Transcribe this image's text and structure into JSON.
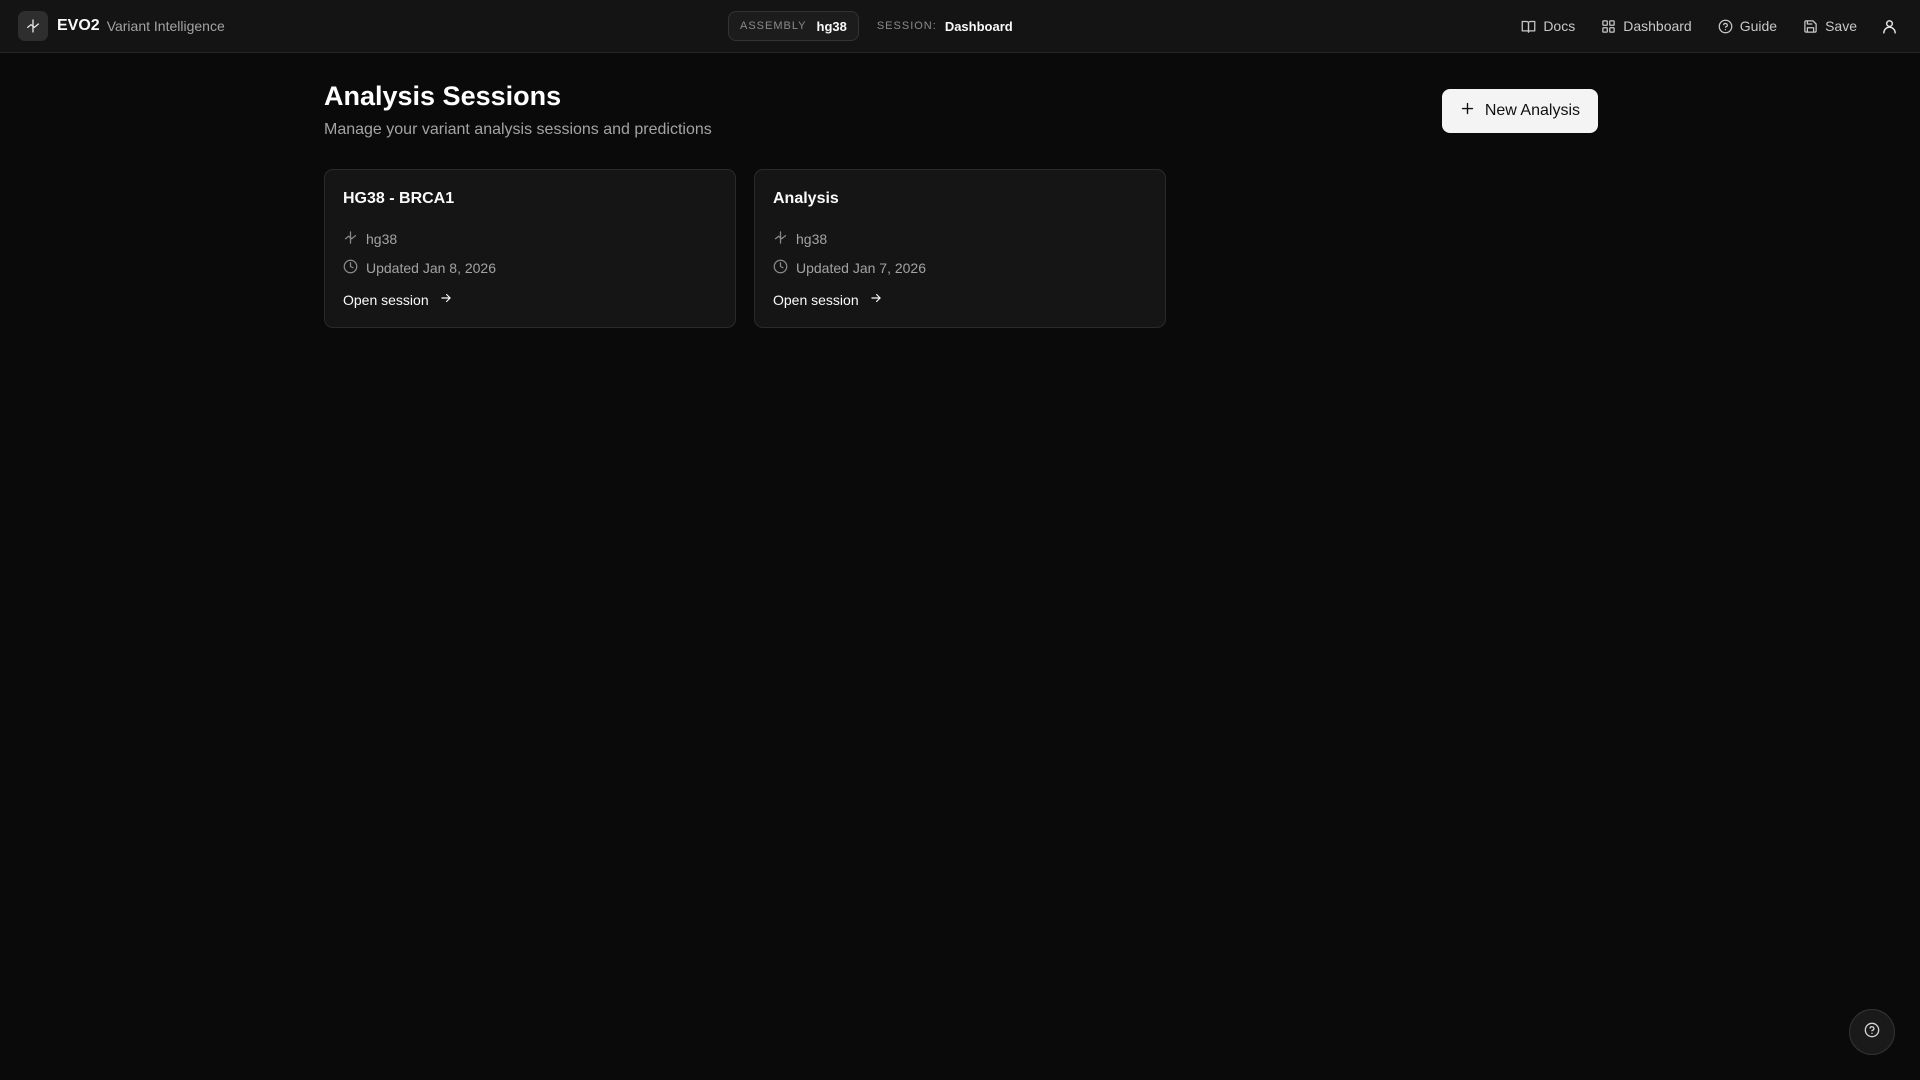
{
  "header": {
    "brand_name": "EVO2",
    "brand_subtitle": "Variant Intelligence",
    "assembly_label": "ASSEMBLY",
    "assembly_value": "hg38",
    "session_label": "SESSION:",
    "session_value": "Dashboard",
    "nav": {
      "docs": "Docs",
      "dashboard": "Dashboard",
      "guide": "Guide",
      "save": "Save"
    }
  },
  "main": {
    "title": "Analysis Sessions",
    "subtitle": "Manage your variant analysis sessions and predictions",
    "new_button_label": "New Analysis",
    "sessions": [
      {
        "title": "HG38 - BRCA1",
        "assembly": "hg38",
        "updated": "Updated Jan 8, 2026",
        "link_label": "Open session"
      },
      {
        "title": "Analysis",
        "assembly": "hg38",
        "updated": "Updated Jan 7, 2026",
        "link_label": "Open session"
      }
    ]
  },
  "icons": {
    "brand": "dna-icon",
    "docs": "book-icon",
    "dashboard": "grid-icon",
    "guide": "help-circle-icon",
    "save": "save-icon",
    "user": "user-icon",
    "new": "plus-icon",
    "assembly": "dna-icon",
    "updated": "clock-icon",
    "open": "arrow-right-icon",
    "help_fab": "help-circle-icon"
  },
  "colors": {
    "background": "#0a0a0a",
    "topbar": "#141414",
    "card": "#151515",
    "primary_button": "#f4f4f4"
  }
}
